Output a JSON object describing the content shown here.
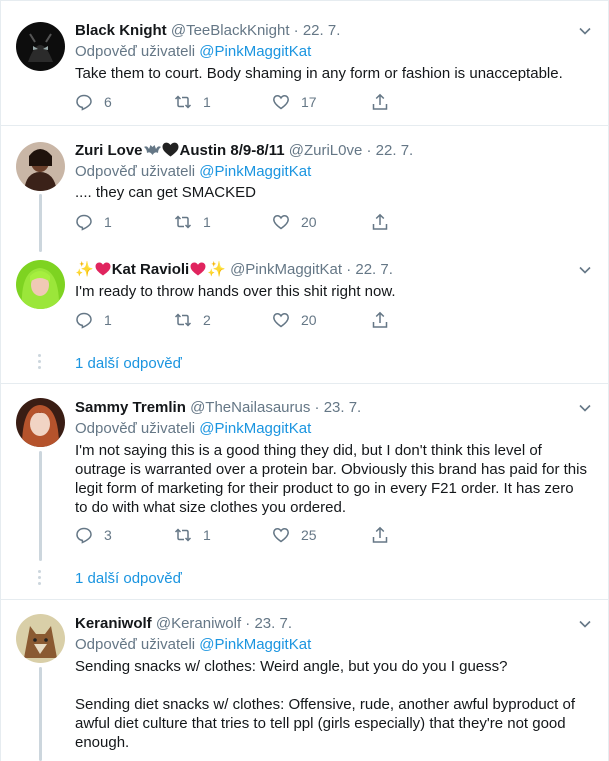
{
  "reply_prefix": "Odpověď uživateli",
  "colors": {
    "link": "#1b95e0",
    "muted": "#657786",
    "divider": "#e6ecf0",
    "thread": "#ccd6dd"
  },
  "tweets": [
    {
      "name": "Black Knight",
      "handle": "@TeeBlackKnight",
      "date": "22. 7.",
      "reply_to": "@PinkMaggitKat",
      "text": "Take them to court. Body shaming in any form or fashion is unacceptable.",
      "replies": "6",
      "retweets": "1",
      "likes": "17"
    },
    {
      "name_before": "Zuri Love",
      "name_after": "Austin 8/9-8/11",
      "handle": "@ZuriL0ve",
      "date": "22. 7.",
      "reply_to": "@PinkMaggitKat",
      "text": ".... they can get SMACKED",
      "replies": "1",
      "retweets": "1",
      "likes": "20"
    },
    {
      "name_mid": "Kat Ravioli",
      "handle": "@PinkMaggitKat",
      "date": "22. 7.",
      "text": "I'm ready to throw hands over this shit right now.",
      "replies": "1",
      "retweets": "2",
      "likes": "20"
    },
    {
      "name": "Sammy Tremlin",
      "handle": "@TheNailasaurus",
      "date": "23. 7.",
      "reply_to": "@PinkMaggitKat",
      "text": "I'm not saying this is a good thing they did, but I don't think this level of outrage is warranted over a protein bar. Obviously this brand has paid for this legit form of marketing for their product to go in every F21 order. It has zero to do with what size clothes you ordered.",
      "replies": "3",
      "retweets": "1",
      "likes": "25"
    },
    {
      "name": "Keraniwolf",
      "handle": "@Keraniwolf",
      "date": "23. 7.",
      "reply_to": "@PinkMaggitKat",
      "text": "Sending snacks w/ clothes: Weird angle, but you do you I guess?\n\nSending diet snacks w/ clothes: Offensive, rude, another awful byproduct of awful diet culture that tries to tell ppl (girls especially) that they're not good enough."
    }
  ],
  "more_replies": [
    "1 další odpověď",
    "1 další odpověď"
  ]
}
